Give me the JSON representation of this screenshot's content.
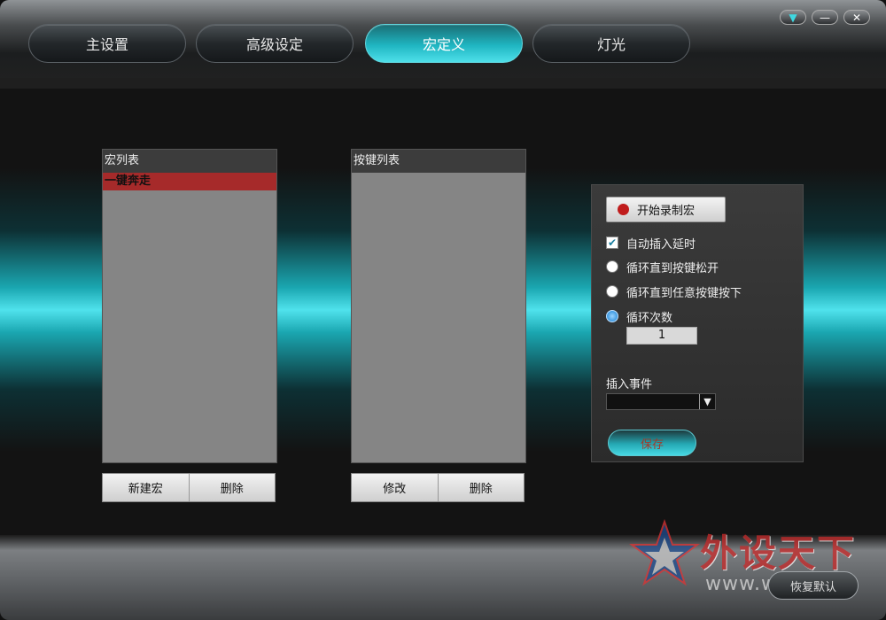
{
  "tabs": [
    {
      "label": "主设置"
    },
    {
      "label": "高级设定"
    },
    {
      "label": "宏定义"
    },
    {
      "label": "灯光"
    }
  ],
  "active_tab": "宏定义",
  "window_controls": {
    "menu": "▼",
    "minimize": "—",
    "close": "✕"
  },
  "macro_list": {
    "title": "宏列表",
    "items": [
      "一键奔走"
    ],
    "new_button": "新建宏",
    "delete_button": "删除"
  },
  "key_list": {
    "title": "按键列表",
    "modify_button": "修改",
    "delete_button": "删除"
  },
  "options": {
    "record_button": "开始录制宏",
    "auto_delay": {
      "label": "自动插入延时",
      "checked": true
    },
    "loop_until_release": {
      "label": "循环直到按键松开",
      "selected": false
    },
    "loop_until_any_key": {
      "label": "循环直到任意按键按下",
      "selected": false
    },
    "loop_count": {
      "label": "循环次数",
      "selected": true,
      "value": "1"
    },
    "insert_event_label": "插入事件",
    "insert_event_value": "",
    "save_button": "保存"
  },
  "footer": {
    "restore_button": "恢复默认"
  },
  "watermark": {
    "text": "外设天下",
    "url": "www.wsh"
  },
  "colors": {
    "accent": "#1fb5c1",
    "selected_row": "#a62a2a",
    "record_dot": "#c01c1c"
  }
}
